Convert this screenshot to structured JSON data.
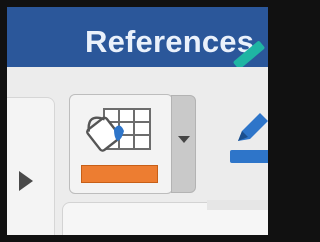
{
  "window": {
    "tab_title": "References"
  },
  "ribbon": {
    "shading": {
      "icon": "paint-bucket-table-icon",
      "color": "#ED7D31"
    },
    "shading_dropdown": {
      "icon": "chevron-down-icon"
    },
    "left_scroll": {
      "icon": "chevron-right-icon"
    },
    "highlight": {
      "icon": "pen-icon",
      "color": "#2E75C9"
    }
  },
  "colors": {
    "title_bar": "#2B579A",
    "accent_teal": "#1FB5A3"
  }
}
